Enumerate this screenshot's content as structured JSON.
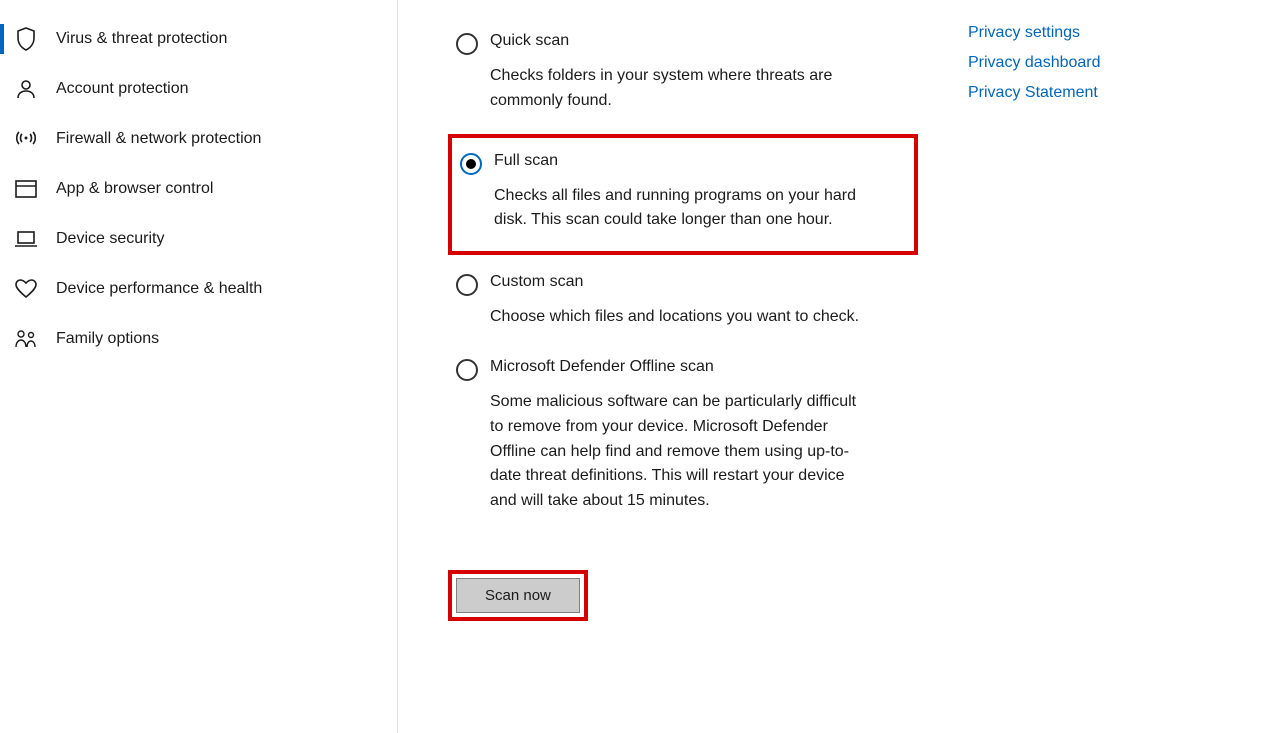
{
  "sidebar": {
    "items": [
      {
        "label": "Virus & threat protection",
        "active": true
      },
      {
        "label": "Account protection",
        "active": false
      },
      {
        "label": "Firewall & network protection",
        "active": false
      },
      {
        "label": "App & browser control",
        "active": false
      },
      {
        "label": "Device security",
        "active": false
      },
      {
        "label": "Device performance & health",
        "active": false
      },
      {
        "label": "Family options",
        "active": false
      }
    ]
  },
  "scanOptions": [
    {
      "title": "Quick scan",
      "desc": "Checks folders in your system where threats are commonly found.",
      "selected": false,
      "highlight": false
    },
    {
      "title": "Full scan",
      "desc": "Checks all files and running programs on your hard disk. This scan could take longer than one hour.",
      "selected": true,
      "highlight": true
    },
    {
      "title": "Custom scan",
      "desc": "Choose which files and locations you want to check.",
      "selected": false,
      "highlight": false
    },
    {
      "title": "Microsoft Defender Offline scan",
      "desc": "Some malicious software can be particularly difficult to remove from your device. Microsoft Defender Offline can help find and remove them using up-to-date threat definitions. This will restart your device and will take about 15 minutes.",
      "selected": false,
      "highlight": false
    }
  ],
  "scanButton": {
    "label": "Scan now"
  },
  "rightLinks": [
    {
      "label": "Privacy settings"
    },
    {
      "label": "Privacy dashboard"
    },
    {
      "label": "Privacy Statement"
    }
  ]
}
